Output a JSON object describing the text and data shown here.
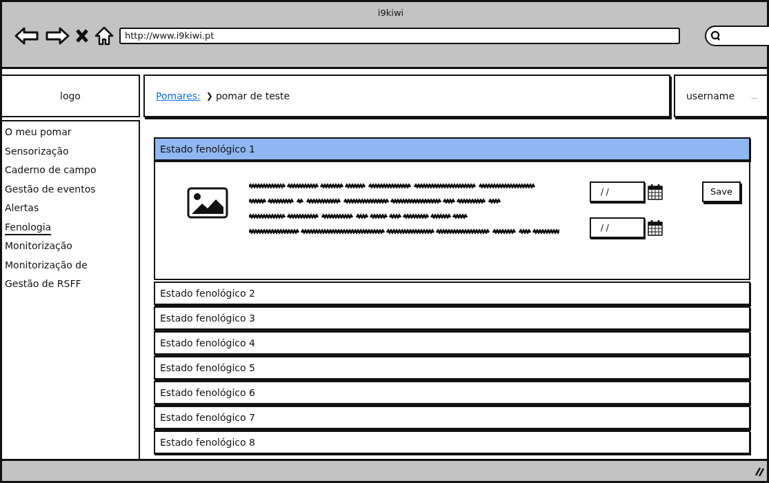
{
  "window": {
    "title": "i9kiwi"
  },
  "browser": {
    "url": "http://www.i9kiwi.pt"
  },
  "header": {
    "logo": "logo",
    "breadcrumb": {
      "link": "Pomares:",
      "separator": "❯",
      "current": "pomar de teste"
    },
    "user": "username",
    "user_more": "..."
  },
  "sidebar": {
    "items": [
      {
        "label": "O meu pomar",
        "selected": false
      },
      {
        "label": "Sensorização",
        "selected": false
      },
      {
        "label": "Caderno de campo",
        "selected": false
      },
      {
        "label": "Gestão de eventos",
        "selected": false
      },
      {
        "label": "Alertas",
        "selected": false
      },
      {
        "label": "Fenologia",
        "selected": true
      },
      {
        "label": "Monitorização",
        "selected": false
      },
      {
        "label": "Monitorização de",
        "selected": false
      },
      {
        "label": "Gestão de RSFF",
        "selected": false
      }
    ]
  },
  "accordion": [
    {
      "title": "Estado fenológico 1",
      "expanded": true,
      "dates": [
        {
          "value": "/ /"
        },
        {
          "value": "/ /"
        }
      ],
      "button": "Save"
    },
    {
      "title": "Estado fenológico 2",
      "expanded": false
    },
    {
      "title": "Estado fenológico 3",
      "expanded": false
    },
    {
      "title": "Estado fenológico 4",
      "expanded": false
    },
    {
      "title": "Estado fenológico 5",
      "expanded": false
    },
    {
      "title": "Estado fenológico 6",
      "expanded": false
    },
    {
      "title": "Estado fenológico 7",
      "expanded": false
    },
    {
      "title": "Estado fenológico 8",
      "expanded": false
    }
  ]
}
